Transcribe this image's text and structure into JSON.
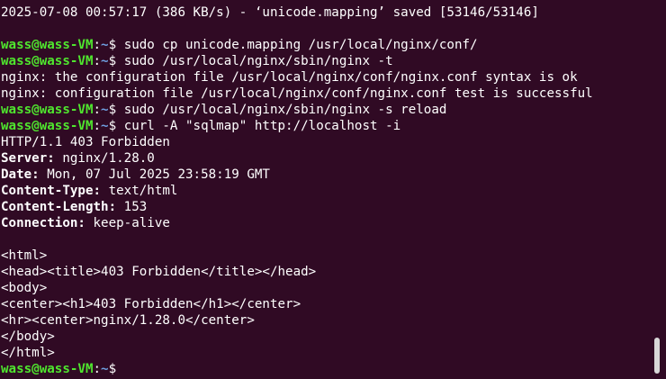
{
  "terminal": {
    "status_line": "2025-07-08 00:57:17 (386 KB/s) - ‘unicode.mapping’ saved [53146/53146]",
    "prompt": {
      "user_host": "wass@wass-VM",
      "separator": ":",
      "path": "~",
      "symbol": "$ "
    },
    "commands": [
      "sudo cp unicode.mapping /usr/local/nginx/conf/",
      "sudo /usr/local/nginx/sbin/nginx -t",
      "sudo /usr/local/nginx/sbin/nginx -s reload",
      "curl -A \"sqlmap\" http://localhost -i"
    ],
    "nginx_test_output": [
      "nginx: the configuration file /usr/local/nginx/conf/nginx.conf syntax is ok",
      "nginx: configuration file /usr/local/nginx/conf/nginx.conf test is successful"
    ],
    "http_status": "HTTP/1.1 403 Forbidden",
    "headers": [
      {
        "key": "Server",
        "value": " nginx/1.28.0"
      },
      {
        "key": "Date",
        "value": " Mon, 07 Jul 2025 23:58:19 GMT"
      },
      {
        "key": "Content-Type",
        "value": " text/html"
      },
      {
        "key": "Content-Length",
        "value": " 153"
      },
      {
        "key": "Connection",
        "value": " keep-alive"
      }
    ],
    "header_colon": ":",
    "body_lines": [
      "<html>",
      "<head><title>403 Forbidden</title></head>",
      "<body>",
      "<center><h1>403 Forbidden</h1></center>",
      "<hr><center>nginx/1.28.0</center>",
      "</body>",
      "</html>"
    ]
  },
  "colors": {
    "background": "#300a24",
    "prompt_user": "#4fe62e",
    "prompt_path": "#6f9fe0",
    "text": "#ffffff"
  }
}
